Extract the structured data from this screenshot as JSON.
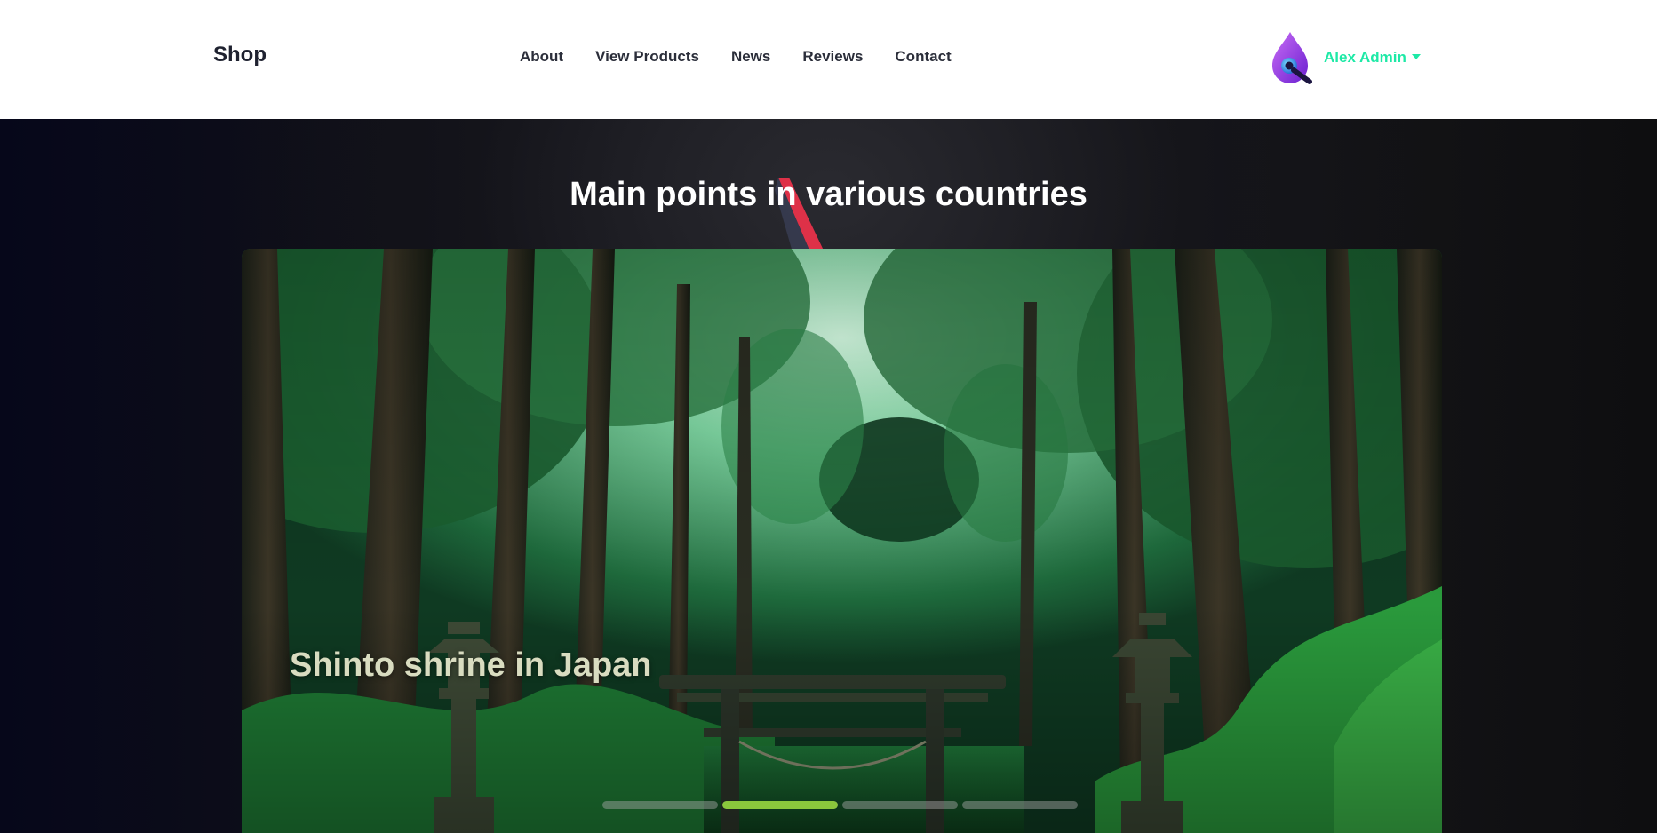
{
  "header": {
    "brand": "Shop",
    "nav": [
      {
        "label": "About"
      },
      {
        "label": "View Products"
      },
      {
        "label": "News"
      },
      {
        "label": "Reviews"
      },
      {
        "label": "Contact"
      }
    ],
    "user": {
      "name": "Alex Admin",
      "avatar_icon": "purple-drop-avatar-icon"
    }
  },
  "hero": {
    "title": "Main points in various countries",
    "slide": {
      "caption": "Shinto shrine in Japan",
      "image": "forest-torii-gate-image"
    },
    "indicators": [
      {
        "progress": 0
      },
      {
        "progress": 1.0
      },
      {
        "progress": 0
      },
      {
        "progress": 0
      }
    ]
  },
  "colors": {
    "accent": "#1de9a6",
    "indicator_active": "#8ac83c",
    "header_bg": "#ffffff",
    "hero_bg": "#141418"
  }
}
